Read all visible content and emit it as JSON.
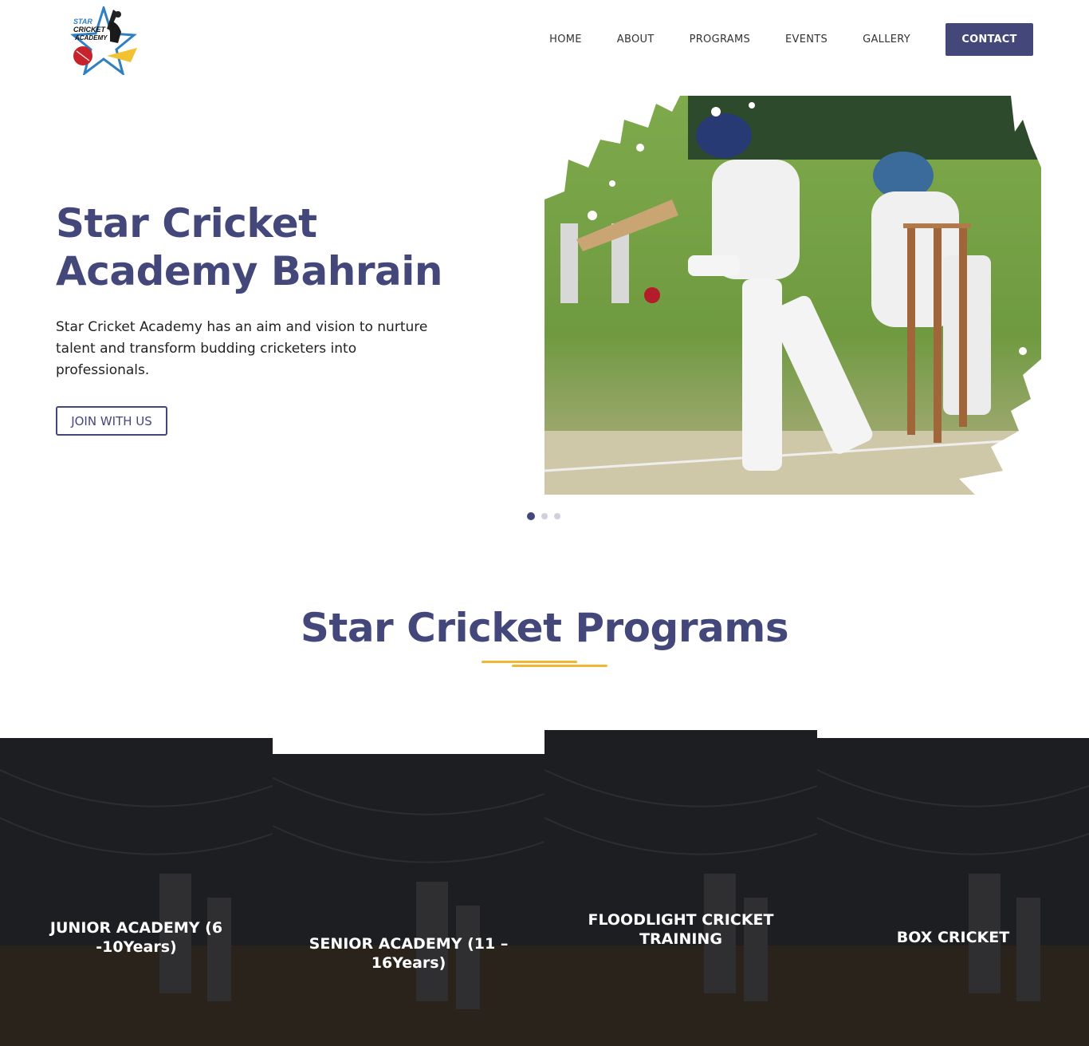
{
  "header": {
    "logo_alt": "Star Cricket Academy logo",
    "logo_text": [
      "STAR",
      "CRICKET",
      "ACADEMY"
    ],
    "nav": [
      "HOME",
      "ABOUT",
      "PROGRAMS",
      "EVENTS",
      "GALLERY"
    ],
    "contact_label": "CONTACT"
  },
  "hero": {
    "title": "Star Cricket Academy Bahrain",
    "description": "Star Cricket Academy has an aim and vision to nurture talent and transform budding cricketers into professionals.",
    "cta_label": "JOIN WITH US",
    "slides_total": 3,
    "active_slide": 1
  },
  "programs": {
    "title": "Star Cricket Programs",
    "cards": [
      {
        "label": "JUNIOR ACADEMY (6 -10Years)"
      },
      {
        "label": "SENIOR ACADEMY (11 – 16Years)"
      },
      {
        "label": "FLOODLIGHT CRICKET TRAINING"
      },
      {
        "label": "BOX CRICKET"
      }
    ]
  },
  "colors": {
    "primary": "#44477a",
    "accent": "#f2b635",
    "card_overlay": "#1c1c20"
  }
}
